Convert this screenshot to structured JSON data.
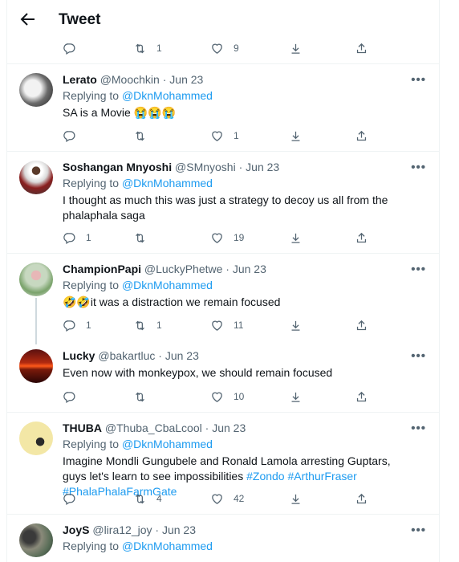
{
  "header": {
    "title": "Tweet"
  },
  "top_actions": {
    "reply": "",
    "retweet": "1",
    "like": "9"
  },
  "tweets": [
    {
      "name": "Lerato",
      "handle": "@Moochkin",
      "date": "Jun 23",
      "replying_to": "@DknMohammed",
      "text": "SA is a Movie 😭😭😭",
      "reply": "",
      "retweet": "",
      "like": "1"
    },
    {
      "name": "Soshangan Mnyoshi",
      "handle": "@SMnyoshi",
      "date": "Jun 23",
      "replying_to": "@DknMohammed",
      "text": "I thought as much this was just a strategy to decoy us all from the phalaphala saga",
      "reply": "1",
      "retweet": "",
      "like": "19"
    },
    {
      "name": "ChampionPapi",
      "handle": "@LuckyPhetwe",
      "date": "Jun 23",
      "replying_to": "@DknMohammed",
      "text": "🤣🤣it was a distraction we remain focused",
      "reply": "1",
      "retweet": "1",
      "like": "11"
    },
    {
      "name": "Lucky",
      "handle": "@bakartluc",
      "date": "Jun 23",
      "text": "Even now with monkeypox, we should remain focused",
      "reply": "",
      "retweet": "",
      "like": "10"
    },
    {
      "name": "THUBA",
      "handle": "@Thuba_CbaLcool",
      "date": "Jun 23",
      "replying_to": "@DknMohammed",
      "text": "Imagine Mondli Gungubele and Ronald Lamola arresting Guptars, guys let's learn to see impossibilities",
      "hashtags": [
        "#Zondo",
        "#ArthurFraser",
        "#PhalaPhalaFarmGate"
      ],
      "reply": "",
      "retweet": "4",
      "like": "42"
    },
    {
      "name": "JoyS",
      "handle": "@lira12_joy",
      "date": "Jun 23",
      "replying_to": "@DknMohammed"
    }
  ],
  "labels": {
    "replying_prefix": "Replying to ",
    "dot": " · ",
    "more": "•••"
  },
  "colors": {
    "accent": "#1d9bf0",
    "muted": "#536471",
    "border": "#eff3f4"
  }
}
